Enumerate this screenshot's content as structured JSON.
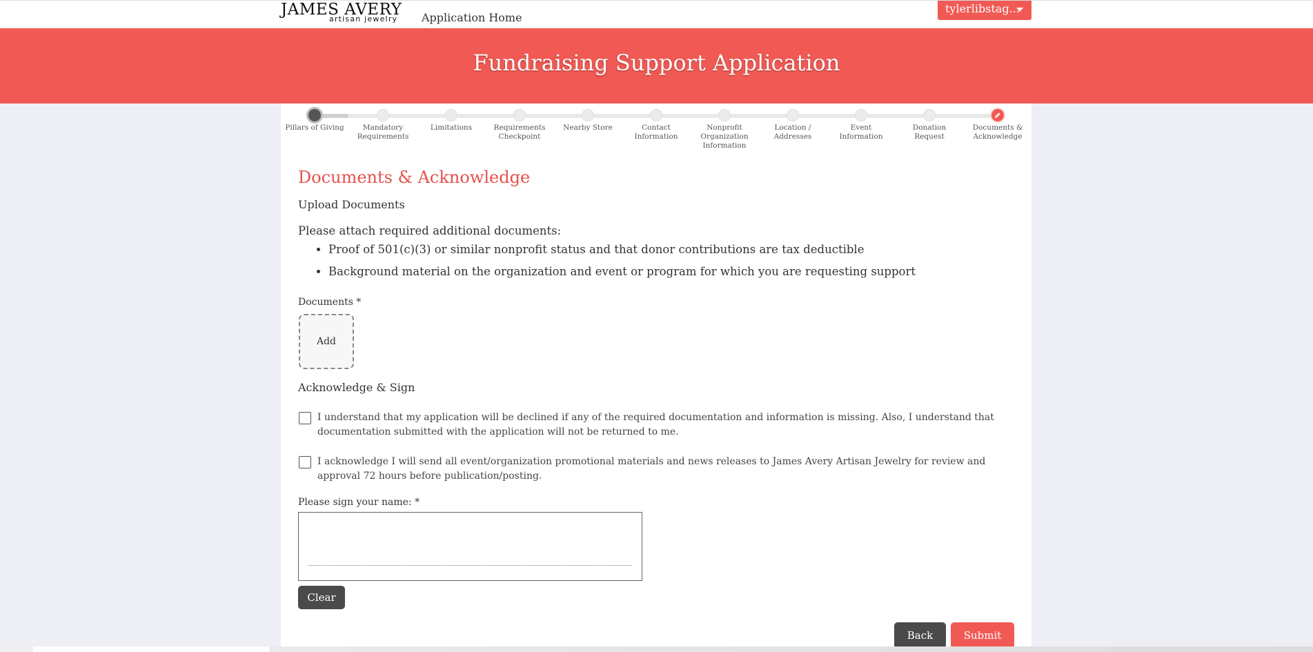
{
  "header": {
    "logo_main": "JAMES AVERY",
    "logo_sub": "artisan jewelry",
    "app_home": "Application Home",
    "user_menu": "tylerlibstag..."
  },
  "banner": {
    "title": "Fundraising Support Application"
  },
  "steps": [
    {
      "label": "Pillars of Giving",
      "state": "done"
    },
    {
      "label": "Mandatory Requirements",
      "state": "pending"
    },
    {
      "label": "Limitations",
      "state": "pending"
    },
    {
      "label": "Requirements Checkpoint",
      "state": "pending"
    },
    {
      "label": "Nearby Store",
      "state": "pending"
    },
    {
      "label": "Contact Information",
      "state": "pending"
    },
    {
      "label": "Nonprofit Organization Information",
      "state": "pending"
    },
    {
      "label": "Location / Addresses",
      "state": "pending"
    },
    {
      "label": "Event Information",
      "state": "pending"
    },
    {
      "label": "Donation Request",
      "state": "pending"
    },
    {
      "label": "Documents & Acknowledge",
      "state": "active"
    }
  ],
  "main": {
    "title": "Documents & Acknowledge",
    "upload_heading": "Upload Documents",
    "instructions": "Please attach required additional documents:",
    "requirements": [
      "Proof of 501(c)(3) or similar nonprofit status and that donor contributions are tax deductible",
      "Background material on the organization and event or program for which you are requesting support"
    ],
    "documents_label": "Documents *",
    "add_label": "Add",
    "acknowledge_heading": "Acknowledge & Sign",
    "acknowledgements": [
      "I understand that my application will be declined if any of the required documentation and information is missing. Also, I understand that documentation submitted with the application will not be returned to me.",
      "I acknowledge I will send all event/organization promotional materials and news releases to James Avery Artisan Jewelry for review and approval 72 hours before publication/posting."
    ],
    "sign_label": "Please sign your name: *",
    "clear_label": "Clear",
    "back_label": "Back",
    "submit_label": "Submit"
  },
  "colors": {
    "accent": "#f15a54",
    "dark_button": "#4a4a4a",
    "page_bg": "#eeeef5"
  }
}
